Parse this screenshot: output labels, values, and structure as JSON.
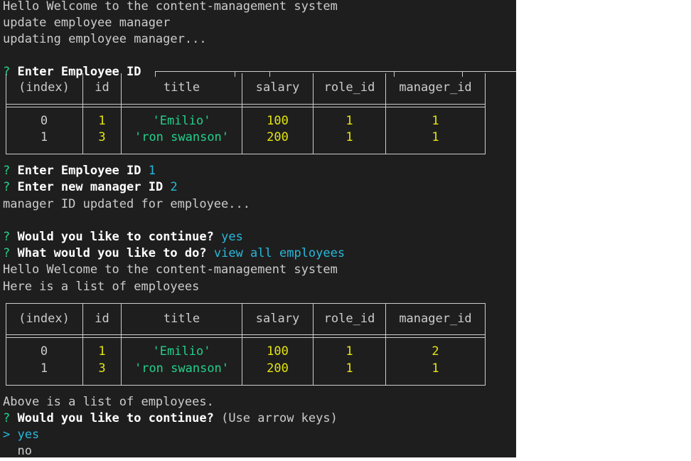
{
  "terminal": {
    "lines_top": [
      "Hello Welcome to the content-management system",
      "update employee manager",
      "updating employee manager..."
    ],
    "prompt_mark": "?",
    "prompt_enter_id": "Enter Employee ID",
    "table_headers": [
      "(index)",
      "id",
      "title",
      "salary",
      "role_id",
      "manager_id"
    ],
    "table1_rows": [
      [
        "0",
        "1",
        "'Emilio'",
        "100",
        "1",
        "1"
      ],
      [
        "1",
        "3",
        "'ron swanson'",
        "200",
        "1",
        "1"
      ]
    ],
    "answer_employee_id": "1",
    "prompt_new_manager": "Enter new manager ID",
    "answer_manager_id": "2",
    "msg_manager_updated": "manager ID updated for employee...",
    "prompt_continue": "Would you like to continue?",
    "answer_continue": "yes",
    "prompt_what_to_do": "What would you like to do?",
    "answer_what_to_do": "view all employees",
    "line_welcome2": "Hello Welcome to the content-management system",
    "line_list_intro": "Here is a list of employees",
    "table2_rows": [
      [
        "0",
        "1",
        "'Emilio'",
        "100",
        "1",
        "2"
      ],
      [
        "1",
        "3",
        "'ron swanson'",
        "200",
        "1",
        "1"
      ]
    ],
    "line_above": "Above is a list of employees.",
    "hint_arrow_keys": "(Use arrow keys)",
    "pointer": ">",
    "choices": [
      "yes",
      "no"
    ]
  }
}
